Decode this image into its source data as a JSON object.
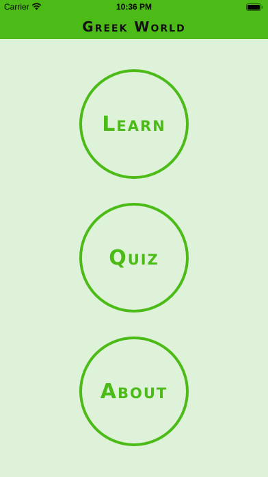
{
  "status_bar": {
    "carrier": "Carrier",
    "time": "10:36 PM"
  },
  "header": {
    "title": "Greek World",
    "background_color": "#4cbb17"
  },
  "menu": {
    "buttons": [
      {
        "label": "Learn"
      },
      {
        "label": "Quiz"
      },
      {
        "label": "About"
      }
    ],
    "accent_color": "#4cbb17"
  },
  "page": {
    "background_color": "#ddf2d8"
  }
}
